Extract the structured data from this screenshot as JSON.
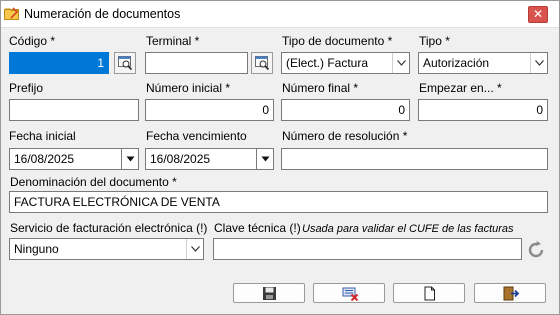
{
  "window": {
    "title": "Numeración de documentos",
    "close_icon": "close-x-icon",
    "close_color": "#d9534f"
  },
  "form": {
    "codigo": {
      "label": "Código *",
      "value": "1"
    },
    "terminal": {
      "label": "Terminal *",
      "value": ""
    },
    "tipo_documento": {
      "label": "Tipo de documento *",
      "value": "(Elect.) Factura"
    },
    "tipo": {
      "label": "Tipo *",
      "value": "Autorización"
    },
    "prefijo": {
      "label": "Prefijo",
      "value": ""
    },
    "numero_inicial": {
      "label": "Número inicial *",
      "value": "0"
    },
    "numero_final": {
      "label": "Número final *",
      "value": "0"
    },
    "empezar_en": {
      "label": "Empezar en... *",
      "value": "0"
    },
    "fecha_inicial": {
      "label": "Fecha inicial",
      "value": "16/08/2025"
    },
    "fecha_vencimiento": {
      "label": "Fecha vencimiento",
      "value": "16/08/2025"
    },
    "numero_resolucion": {
      "label": "Número de resolución *",
      "value": ""
    },
    "denominacion": {
      "label": "Denominación del documento *",
      "value": "FACTURA ELECTRÓNICA DE VENTA"
    },
    "servicio": {
      "label": "Servicio de facturación electrónica (!)",
      "value": "Ninguno"
    },
    "clave_tecnica": {
      "label": "Clave técnica (!)",
      "note": "Usada para validar el CUFE de las facturas",
      "value": ""
    }
  },
  "toolbar": {
    "save_icon": "floppy-disk-icon",
    "cancel_icon": "keyboard-delete-icon",
    "new_icon": "blank-page-icon",
    "exit_icon": "exit-door-icon"
  },
  "colors": {
    "selection": "#0078d7",
    "close": "#d9534f"
  }
}
